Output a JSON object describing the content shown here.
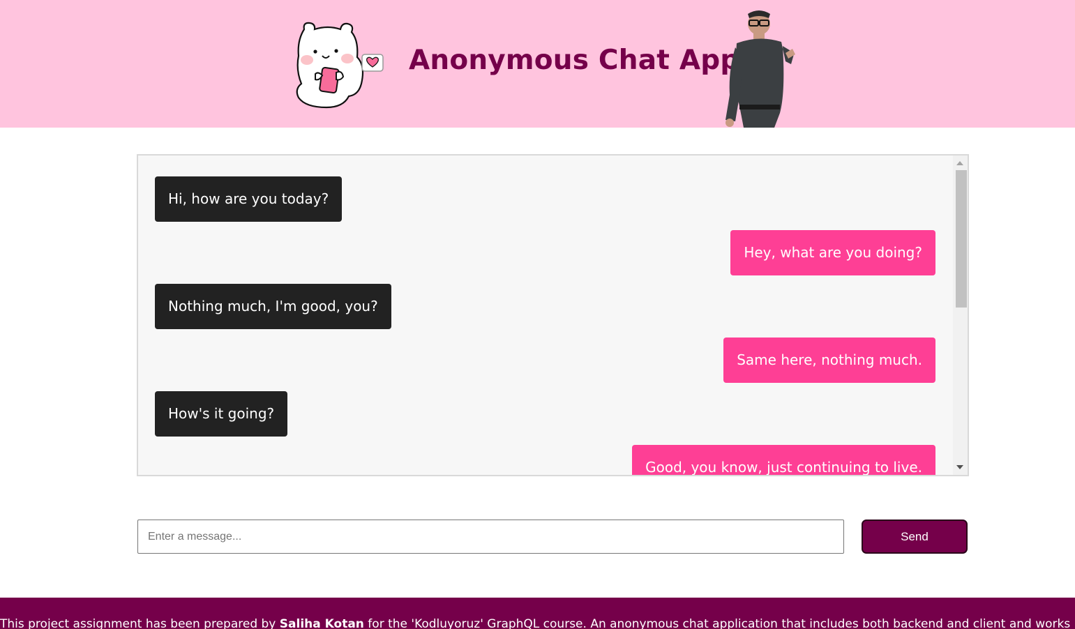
{
  "header": {
    "title": "Anonymous Chat App",
    "background_color": "#ffc4de",
    "title_color": "#75004a",
    "left_image": "bear-with-phone-sticker",
    "right_image": "man-pointing-photo"
  },
  "chat": {
    "messages": [
      {
        "side": "them",
        "text": "Hi, how are you today?"
      },
      {
        "side": "me",
        "text": "Hey, what are you doing?"
      },
      {
        "side": "them",
        "text": "Nothing much, I'm good, you?"
      },
      {
        "side": "me",
        "text": "Same here, nothing much."
      },
      {
        "side": "them",
        "text": "How's it going?"
      },
      {
        "side": "me",
        "text": "Good, you know, just continuing to live."
      }
    ],
    "colors": {
      "them": "#222222",
      "me": "#fe3f95",
      "background": "#f7f7f7"
    }
  },
  "composer": {
    "placeholder": "Enter a message...",
    "value": "",
    "send_label": "Send"
  },
  "footer": {
    "text_before": "This project assignment has been prepared by ",
    "author": "Saliha Kotan",
    "text_after": " for the 'Kodluyoruz' GraphQL course. An anonymous chat application that includes both backend and client and works in real time with Gra",
    "background_color": "#75004a"
  }
}
